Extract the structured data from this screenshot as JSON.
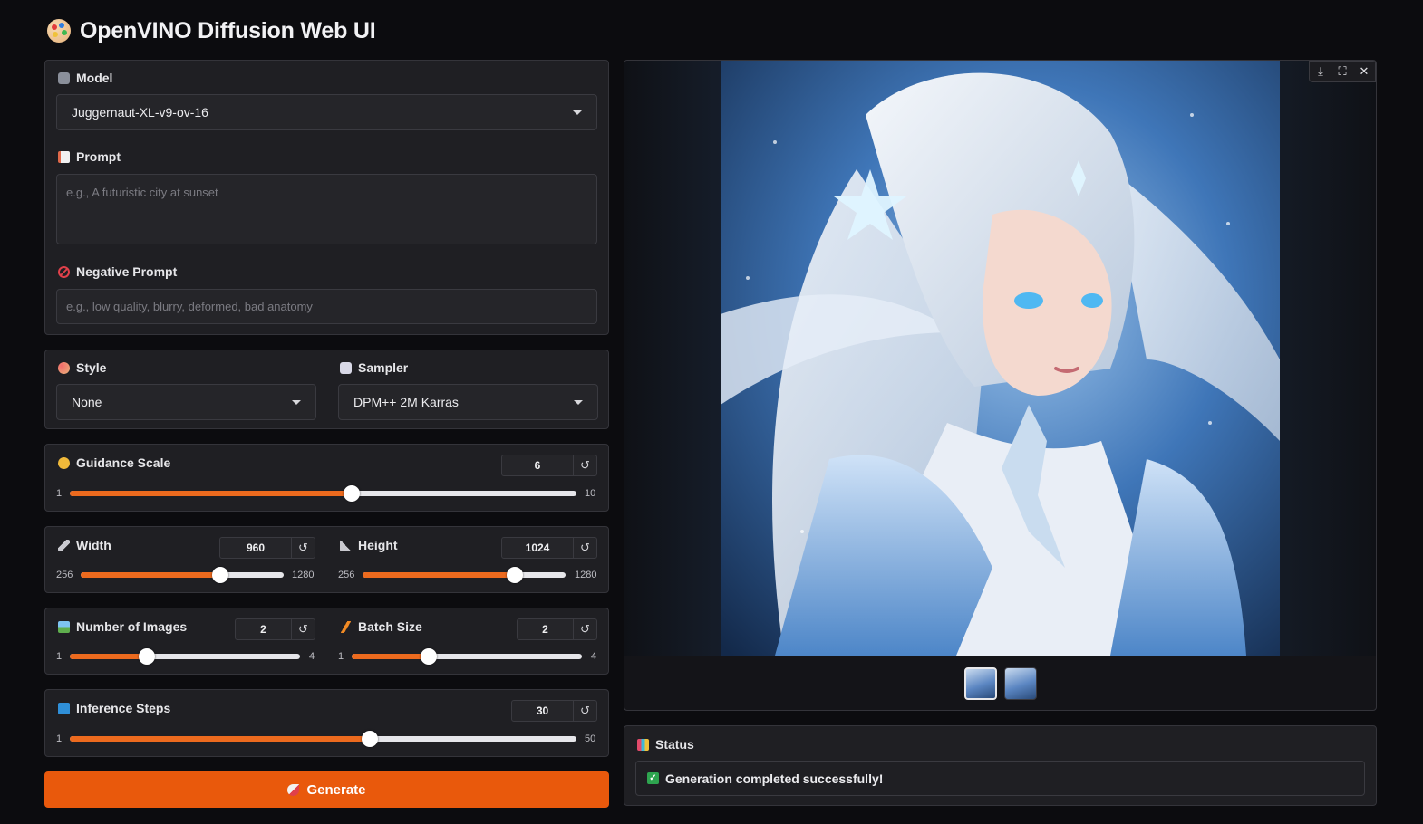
{
  "app": {
    "title": "OpenVINO Diffusion Web UI"
  },
  "model": {
    "label": "Model",
    "selected": "Juggernaut-XL-v9-ov-16"
  },
  "prompt": {
    "label": "Prompt",
    "value": "",
    "placeholder": "e.g., A futuristic city at sunset"
  },
  "negative_prompt": {
    "label": "Negative Prompt",
    "value": "",
    "placeholder": "e.g., low quality, blurry, deformed, bad anatomy"
  },
  "style": {
    "label": "Style",
    "selected": "None"
  },
  "sampler": {
    "label": "Sampler",
    "selected": "DPM++ 2M Karras"
  },
  "guidance": {
    "label": "Guidance Scale",
    "value": 6,
    "min": 1,
    "max": 10,
    "min_label": "1",
    "max_label": "10",
    "value_text": "6"
  },
  "width": {
    "label": "Width",
    "value": 960,
    "min": 256,
    "max": 1280,
    "min_label": "256",
    "max_label": "1280",
    "value_text": "960"
  },
  "height": {
    "label": "Height",
    "value": 1024,
    "min": 256,
    "max": 1280,
    "min_label": "256",
    "max_label": "1280",
    "value_text": "1024"
  },
  "num_images": {
    "label": "Number of Images",
    "value": 2,
    "min": 1,
    "max": 4,
    "min_label": "1",
    "max_label": "4",
    "value_text": "2"
  },
  "batch_size": {
    "label": "Batch Size",
    "value": 2,
    "min": 1,
    "max": 4,
    "min_label": "1",
    "max_label": "4",
    "value_text": "2"
  },
  "steps": {
    "label": "Inference Steps",
    "value": 30,
    "min": 1,
    "max": 50,
    "min_label": "1",
    "max_label": "50",
    "value_text": "30"
  },
  "reset_glyph": "↺",
  "generate": {
    "label": "Generate"
  },
  "gallery": {
    "tools": [
      "download-icon",
      "fullscreen-icon",
      "close-icon"
    ],
    "thumbnail_count": 2,
    "selected_thumbnail": 0
  },
  "status": {
    "label": "Status",
    "message": "Generation completed successfully!"
  },
  "colors": {
    "accent": "#e9590c",
    "slider_fill": "#ec6a1e",
    "success": "#2ea44f",
    "background": "#0c0c0f",
    "panel": "#1f1f23"
  }
}
